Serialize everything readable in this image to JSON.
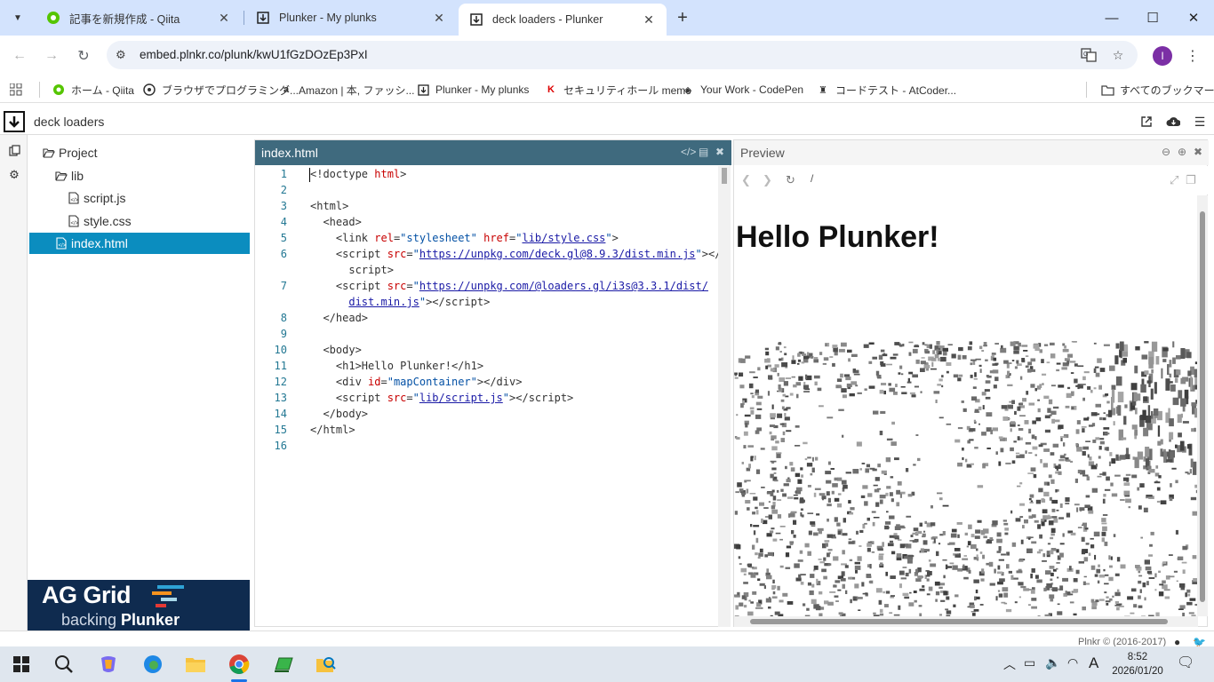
{
  "browser": {
    "tabs": [
      {
        "title": "記事を新規作成 - Qiita",
        "active": false
      },
      {
        "title": "Plunker - My plunks",
        "active": false
      },
      {
        "title": "deck loaders - Plunker",
        "active": true
      }
    ],
    "url": "embed.plnkr.co/plunk/kwU1fGzDOzEp3PxI",
    "profile_initial": "I",
    "bookmarks": [
      "ホーム - Qiita",
      "ブラウザでプログラミング...",
      "Amazon | 本, ファッシ...",
      "Plunker - My plunks",
      "セキュリティホール memo",
      "Your Work - CodePen",
      "コードテスト - AtCoder..."
    ],
    "all_bookmarks": "すべてのブックマーク"
  },
  "plunker": {
    "title": "deck loaders",
    "tree": {
      "root": "Project",
      "folder": "lib",
      "files": [
        "script.js",
        "style.css"
      ],
      "selected": "index.html"
    },
    "ad": {
      "title": "AG Grid",
      "sub_prefix": "backing ",
      "sub_strong": "Plunker"
    },
    "editor": {
      "filename": "index.html",
      "line_numbers": [
        "1",
        "2",
        "3",
        "4",
        "5",
        "6",
        "7",
        "8",
        "9",
        "10",
        "11",
        "12",
        "13",
        "14",
        "15",
        "16"
      ]
    },
    "preview": {
      "title": "Preview",
      "path": "/",
      "heading": "Hello Plunker!"
    },
    "footer": "Plnkr © (2016-2017)"
  },
  "taskbar": {
    "time": "8:52",
    "date": "2026/01/20",
    "ime": "A"
  },
  "colors": {
    "tab_strip": "#d3e3fd",
    "editor_header": "#3f6a7e",
    "tree_selected": "#0b8dbf",
    "ad_background": "#0f2b4f"
  }
}
